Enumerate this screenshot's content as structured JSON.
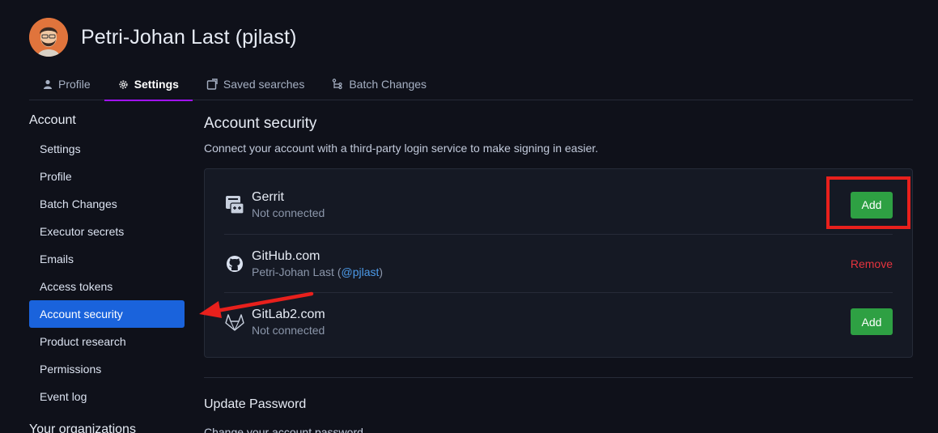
{
  "header": {
    "user_title": "Petri-Johan Last (pjlast)",
    "avatar_alt": "user-avatar"
  },
  "tabs": [
    {
      "label": "Profile",
      "icon": "user-icon",
      "active": false
    },
    {
      "label": "Settings",
      "icon": "gear-icon",
      "active": true
    },
    {
      "label": "Saved searches",
      "icon": "saved-search-icon",
      "active": false
    },
    {
      "label": "Batch Changes",
      "icon": "batch-changes-icon",
      "active": false
    }
  ],
  "sidebar": {
    "heading": "Account",
    "items": [
      {
        "label": "Settings"
      },
      {
        "label": "Profile"
      },
      {
        "label": "Batch Changes"
      },
      {
        "label": "Executor secrets"
      },
      {
        "label": "Emails"
      },
      {
        "label": "Access tokens"
      },
      {
        "label": "Account security",
        "active": true
      },
      {
        "label": "Product research"
      },
      {
        "label": "Permissions"
      },
      {
        "label": "Event log"
      }
    ],
    "heading2": "Your organizations"
  },
  "main": {
    "title": "Account security",
    "description": "Connect your account with a third-party login service to make signing in easier.",
    "services": [
      {
        "name": "Gerrit",
        "status": "Not connected",
        "icon": "gerrit-icon",
        "action": "Add"
      },
      {
        "name": "GitHub.com",
        "status_prefix": "Petri-Johan Last (",
        "handle": "@pjlast",
        "status_suffix": ")",
        "icon": "github-icon",
        "action": "Remove"
      },
      {
        "name": "GitLab2.com",
        "status": "Not connected",
        "icon": "gitlab-icon",
        "action": "Add"
      }
    ],
    "password_title": "Update Password",
    "password_desc": "Change your account password."
  },
  "colors": {
    "background": "#0f111a",
    "accent_tab": "#a112ff",
    "active_nav": "#1a63dc",
    "add_button": "#2ea043",
    "remove": "#e5343e",
    "annotation": "#e8201c"
  }
}
